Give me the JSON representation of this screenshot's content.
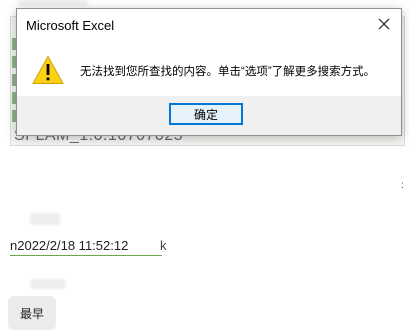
{
  "dialog": {
    "title": "Microsoft Excel",
    "message": "无法找到您所查找的内容。单击“选项”了解更多搜索方式。",
    "ok_label": "确定",
    "close_icon": "close-icon",
    "warning_icon": "warning-triangle-icon"
  },
  "background": {
    "cell_text": "SFLAM_1.0.10707025",
    "timestamp": "2022/2/18 11:52:12",
    "timestamp_prefix": "n",
    "timestamp_tail": "k",
    "chip_label": "最早"
  },
  "colors": {
    "accent": "#0078d7",
    "warning": "#fcd116",
    "footer": "#f0f0f0"
  }
}
